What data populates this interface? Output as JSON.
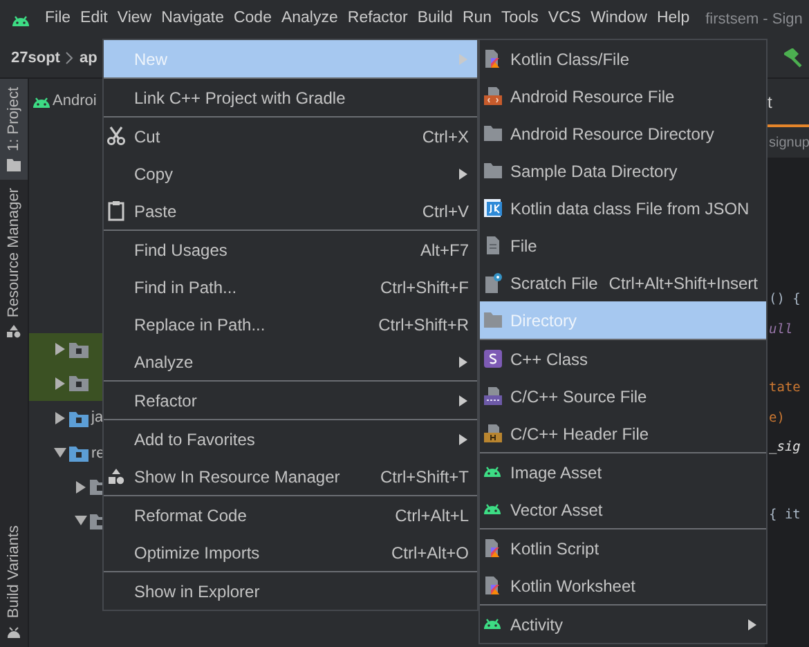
{
  "menu_bar": {
    "items": [
      "File",
      "Edit",
      "View",
      "Navigate",
      "Code",
      "Analyze",
      "Refactor",
      "Build",
      "Run",
      "Tools",
      "VCS",
      "Window",
      "Help"
    ],
    "title": "firstsem - Sign"
  },
  "breadcrumb": [
    "27sopt",
    "ap"
  ],
  "side_tabs": [
    {
      "label": "1: Project",
      "selected": true
    },
    {
      "label": "Resource Manager",
      "selected": false
    },
    {
      "label": "Build Variants",
      "selected": false
    }
  ],
  "project_tree": [
    {
      "label": "Androi",
      "children": [
        {
          "expanded": false,
          "highlighted": true
        },
        {
          "expanded": false,
          "highlighted": true
        },
        {
          "label": "ja",
          "expanded": false,
          "highlighted": false
        },
        {
          "label": "re",
          "expanded": true,
          "highlighted": false,
          "children": [
            {
              "expanded": false,
              "highlighted": false
            },
            {
              "expanded": true,
              "highlighted": false
            }
          ]
        }
      ]
    }
  ],
  "editor": {
    "tab": "t",
    "path": "signup",
    "code_lines": [
      {
        "text": "() {",
        "kind": "plain"
      },
      {
        "text": "ull",
        "kind": "constant"
      },
      {
        "text": "tate",
        "kind": "keyword"
      },
      {
        "text": "e)",
        "kind": "keyword"
      },
      {
        "text": "_sig",
        "kind": "italic"
      },
      {
        "text": "{  it",
        "kind": "plain"
      }
    ]
  },
  "context_menu": [
    {
      "kind": "plain",
      "label": "New",
      "submenu": true,
      "selected": true
    },
    {
      "kind": "separator"
    },
    {
      "kind": "plain",
      "label": "Link C++ Project with Gradle",
      "selected": false
    },
    {
      "kind": "separator"
    },
    {
      "kind": "cut",
      "label": "Cut",
      "shortcut": "Ctrl+X",
      "selected": false
    },
    {
      "kind": "plain",
      "label": "Copy",
      "submenu": true,
      "selected": false
    },
    {
      "kind": "paste",
      "label": "Paste",
      "shortcut": "Ctrl+V",
      "selected": false
    },
    {
      "kind": "separator"
    },
    {
      "kind": "plain",
      "label": "Find Usages",
      "shortcut": "Alt+F7",
      "selected": false
    },
    {
      "kind": "plain",
      "label": "Find in Path...",
      "shortcut": "Ctrl+Shift+F",
      "selected": false
    },
    {
      "kind": "plain",
      "label": "Replace in Path...",
      "shortcut": "Ctrl+Shift+R",
      "selected": false
    },
    {
      "kind": "plain",
      "label": "Analyze",
      "submenu": true,
      "selected": false
    },
    {
      "kind": "separator"
    },
    {
      "kind": "plain",
      "label": "Refactor",
      "submenu": true,
      "selected": false
    },
    {
      "kind": "separator"
    },
    {
      "kind": "plain",
      "label": "Add to Favorites",
      "submenu": true,
      "selected": false
    },
    {
      "kind": "resource-manager",
      "label": "Show In Resource Manager",
      "shortcut": "Ctrl+Shift+T",
      "selected": false
    },
    {
      "kind": "separator"
    },
    {
      "kind": "plain",
      "label": "Reformat Code",
      "shortcut": "Ctrl+Alt+L",
      "selected": false
    },
    {
      "kind": "plain",
      "label": "Optimize Imports",
      "shortcut": "Ctrl+Alt+O",
      "selected": false
    },
    {
      "kind": "separator"
    },
    {
      "kind": "plain",
      "label": "Show in Explorer",
      "selected": false
    }
  ],
  "new_submenu": [
    {
      "kind": "kotlin",
      "label": "Kotlin Class/File",
      "selected": false
    },
    {
      "kind": "resource-file",
      "label": "Android Resource File",
      "selected": false
    },
    {
      "kind": "folder",
      "label": "Android Resource Directory",
      "selected": false
    },
    {
      "kind": "folder",
      "label": "Sample Data Directory",
      "selected": false
    },
    {
      "kind": "json",
      "label": "Kotlin data class File from JSON",
      "selected": false
    },
    {
      "kind": "file",
      "label": "File",
      "selected": false
    },
    {
      "kind": "scratch",
      "label": "Scratch File",
      "shortcut": "Ctrl+Alt+Shift+Insert",
      "selected": false
    },
    {
      "kind": "folder",
      "label": "Directory",
      "selected": true
    },
    {
      "kind": "separator"
    },
    {
      "kind": "cpp-class",
      "label": "C++ Class",
      "selected": false
    },
    {
      "kind": "cpp-source",
      "label": "C/C++ Source File",
      "selected": false
    },
    {
      "kind": "cpp-header",
      "label": "C/C++ Header File",
      "selected": false
    },
    {
      "kind": "separator"
    },
    {
      "kind": "android",
      "label": "Image Asset",
      "selected": false
    },
    {
      "kind": "android",
      "label": "Vector Asset",
      "selected": false
    },
    {
      "kind": "separator"
    },
    {
      "kind": "kotlin",
      "label": "Kotlin Script",
      "selected": false
    },
    {
      "kind": "kotlin",
      "label": "Kotlin Worksheet",
      "selected": false
    },
    {
      "kind": "separator"
    },
    {
      "kind": "android",
      "label": "Activity",
      "submenu": true,
      "selected": false
    }
  ]
}
